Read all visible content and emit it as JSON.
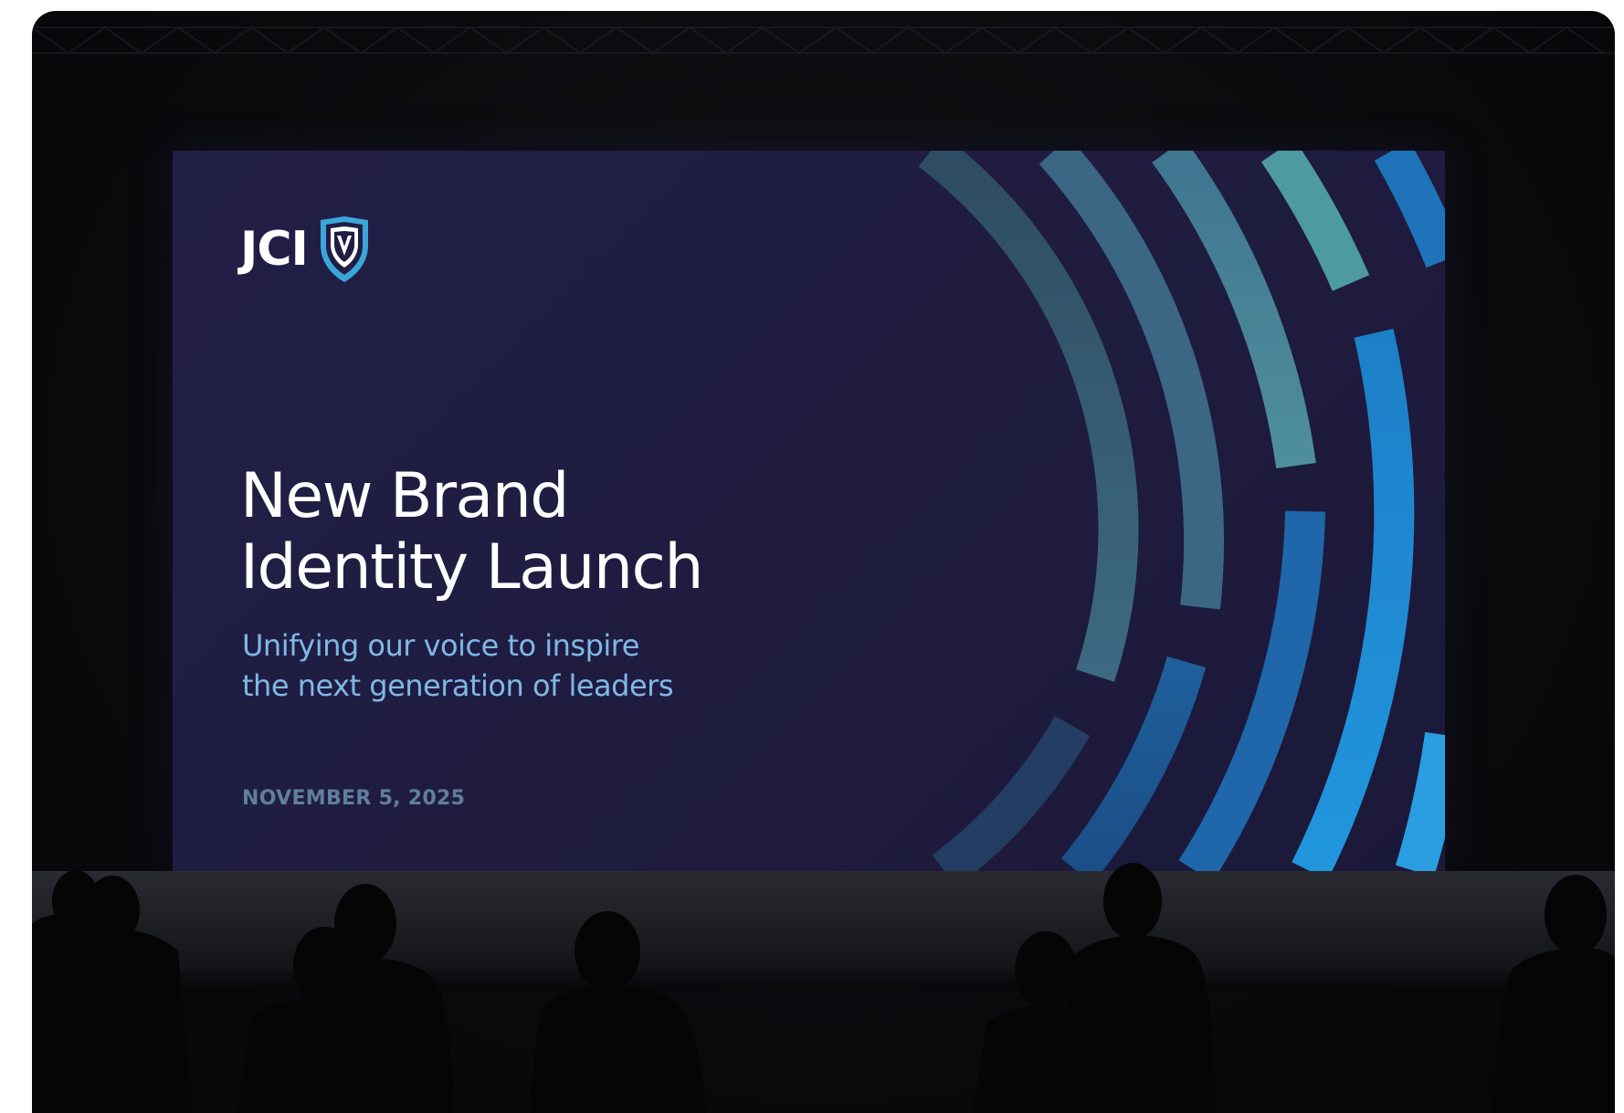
{
  "slide": {
    "logo_text": "JCI",
    "title_line1": "New Brand",
    "title_line2": "Identity Launch",
    "subtitle_line1": "Unifying our voice to inspire",
    "subtitle_line2": "the next generation of leaders",
    "date": "NOVEMBER 5, 2025"
  },
  "icons": {
    "logo_mark": "shield-icon"
  },
  "colors": {
    "slide_background": "#211e45",
    "title": "#ffffff",
    "subtitle": "#7fb8e6",
    "date": "#5f7f9e",
    "arc_teal": "#4f8f9c",
    "arc_slate": "#3a5670",
    "arc_blue": "#1f78c2"
  }
}
